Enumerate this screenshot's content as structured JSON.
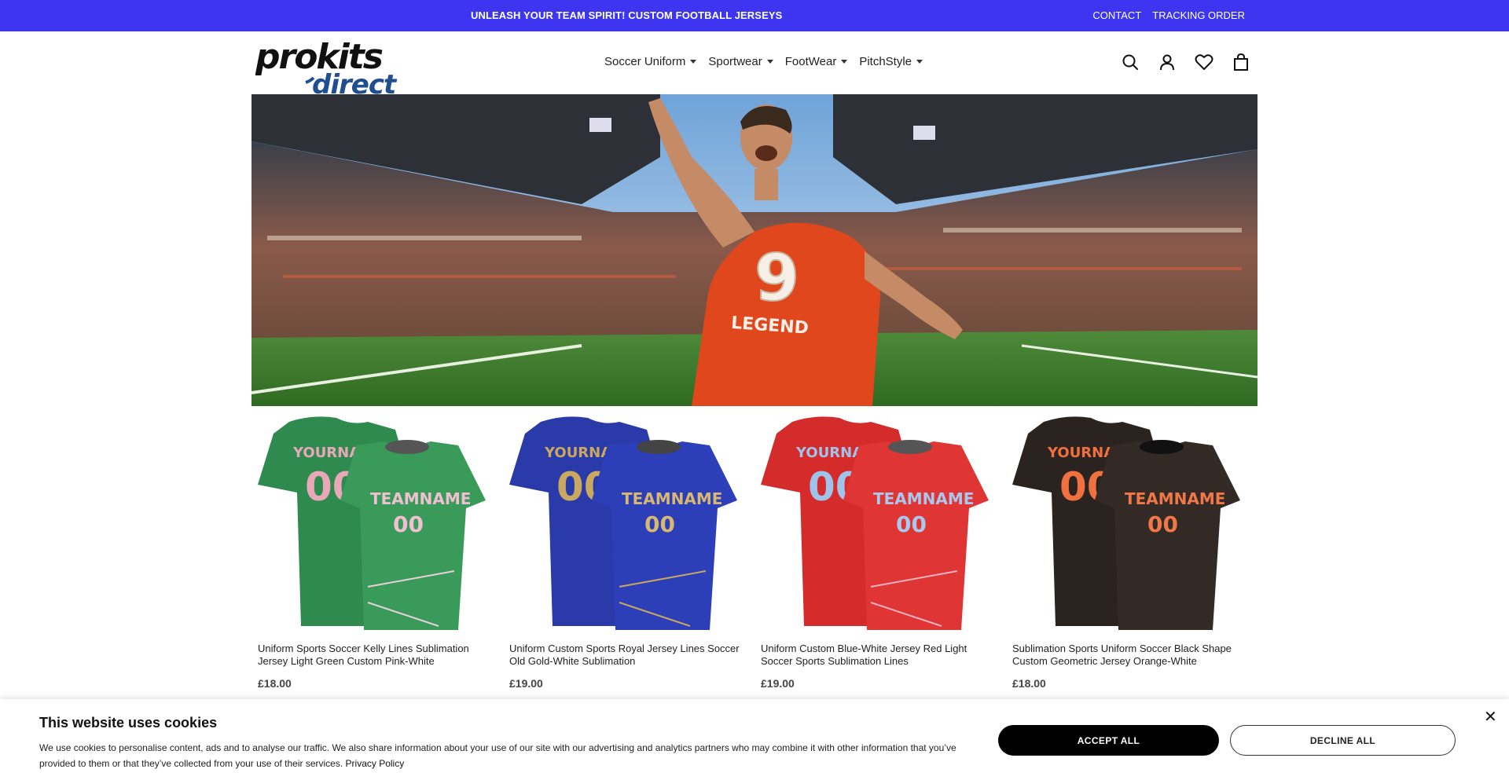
{
  "topbar": {
    "promo": "UNLEASH YOUR TEAM SPIRIT! CUSTOM FOOTBALL JERSEYS",
    "links": [
      "CONTACT",
      "TRACKING ORDER"
    ],
    "color": "#3d35f0"
  },
  "header": {
    "logo_word1": "prokits",
    "logo_word2": "direct",
    "nav": [
      {
        "label": "Soccer Uniform"
      },
      {
        "label": "Sportwear"
      },
      {
        "label": "FootWear"
      },
      {
        "label": "PitchStyle"
      }
    ],
    "icons": [
      "search-icon",
      "account-icon",
      "wishlist-icon",
      "cart-icon"
    ]
  },
  "hero": {
    "jersey_number": "9",
    "jersey_text": "LEGEND"
  },
  "products": [
    {
      "title": "Uniform Sports Soccer Kelly Lines Sublimation Jersey Light Green Custom Pink-White",
      "price": "£18.00",
      "color": "#2e8a4f",
      "accent": "#e8a8b8",
      "yourname": "YOURNAME",
      "teamname": "TEAMNAME",
      "number": "00"
    },
    {
      "title": "Uniform Custom Sports Royal Jersey Lines Soccer Old Gold-White Sublimation",
      "price": "£19.00",
      "color": "#2a3aa8",
      "accent": "#c9a860",
      "yourname": "YOURNAME",
      "teamname": "TEAMNAME",
      "number": "00"
    },
    {
      "title": "Uniform Custom Blue-White Jersey Red Light Soccer Sports Sublimation Lines",
      "price": "£19.00",
      "color": "#d42b2b",
      "accent": "#9fc3ea",
      "yourname": "YOURNAME",
      "teamname": "TEAMNAME",
      "number": "00"
    },
    {
      "title": "Sublimation Sports Uniform Soccer Black Shape Custom Geometric Jersey Orange-White",
      "price": "£18.00",
      "color": "#2b2320",
      "accent": "#f07040",
      "yourname": "YOURNAME",
      "teamname": "TEAMNAME",
      "number": "00"
    }
  ],
  "cookie": {
    "title": "This website uses cookies",
    "text": "We use cookies to personalise content, ads and to analyse our traffic. We also share information about your use of our site with our advertising and analytics partners who may combine it with other information that you’ve provided to them or that they’ve collected from your use of their services.",
    "privacy_link": "Privacy Policy",
    "accept": "ACCEPT ALL",
    "decline": "DECLINE ALL",
    "close": "✕"
  }
}
